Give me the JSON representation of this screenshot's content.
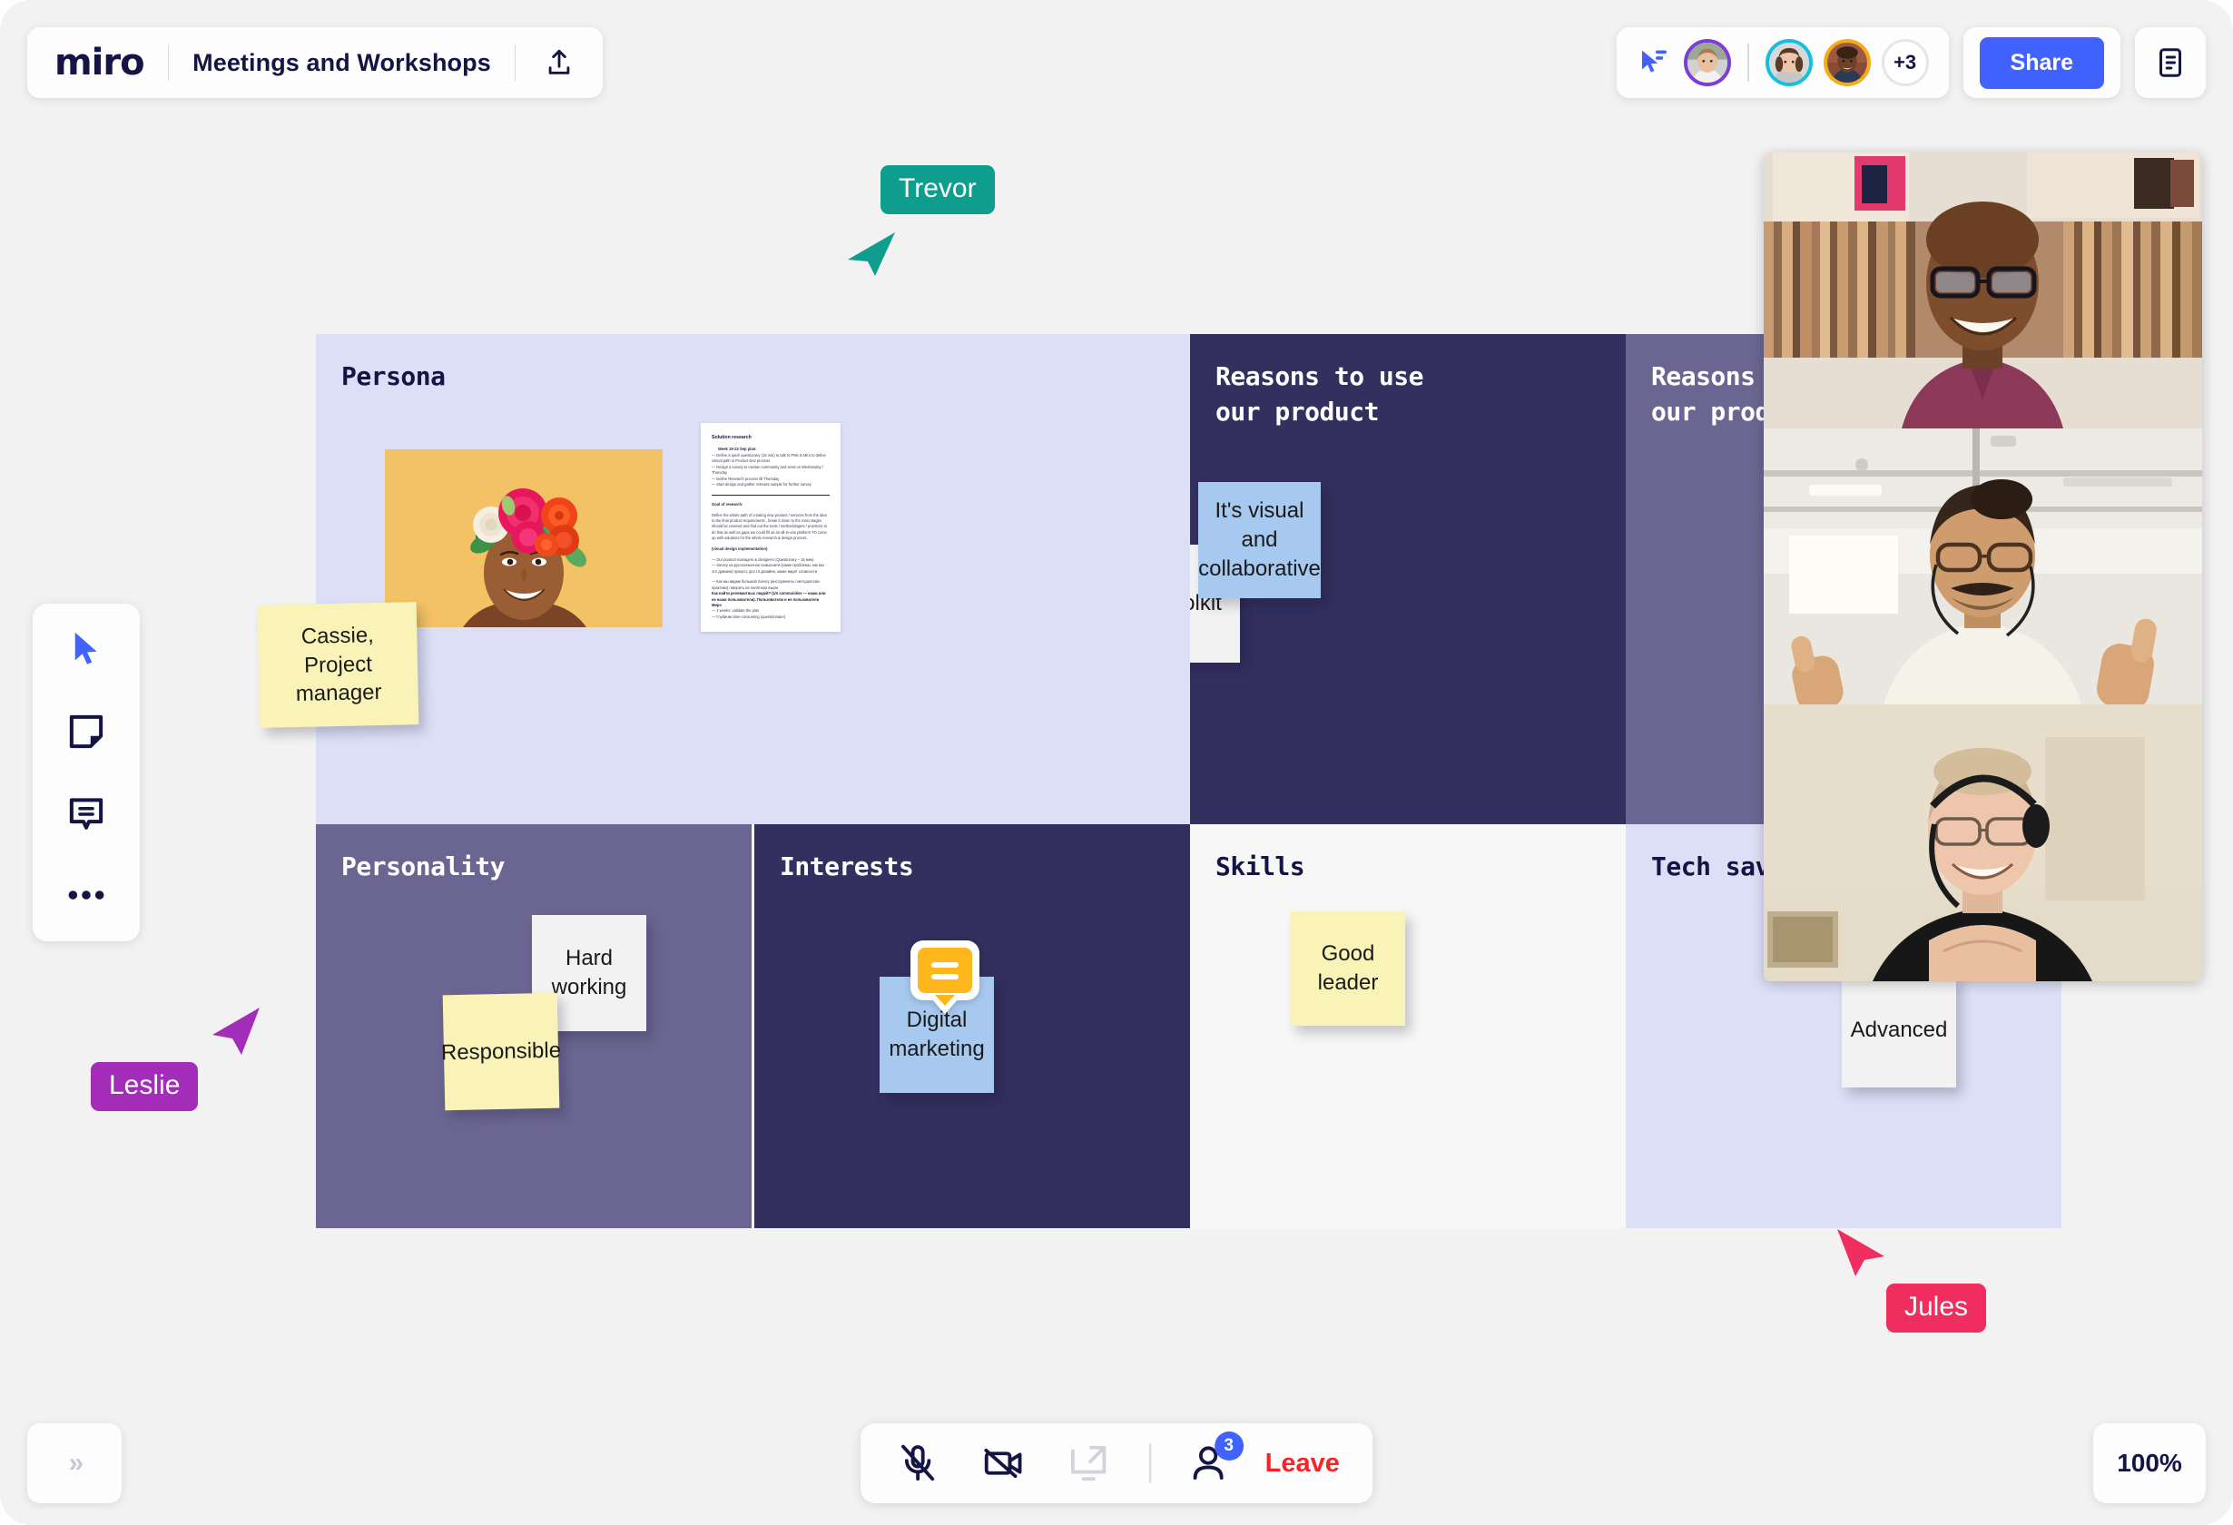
{
  "app": {
    "logo_text": "miro",
    "board_title": "Meetings and Workshops",
    "zoom_level": "100%",
    "expand_label": "»"
  },
  "header": {
    "upload_icon": "upload-icon",
    "follow_cursor_icon": "follow-cursor-icon",
    "share_label": "Share",
    "notes_icon": "notes-panel-icon",
    "overflow_count": "+3",
    "avatars": [
      {
        "name": "avatar-1",
        "ring": "#7b3fd4"
      },
      {
        "name": "avatar-2",
        "ring": "#15c0de"
      },
      {
        "name": "avatar-3",
        "ring": "#f5ac15"
      }
    ]
  },
  "left_toolbar": {
    "items": [
      {
        "icon": "cursor-select-icon",
        "label": "Select",
        "active": true
      },
      {
        "icon": "sticky-note-icon",
        "label": "Sticky note",
        "active": false
      },
      {
        "icon": "comment-icon",
        "label": "Comment",
        "active": false
      },
      {
        "icon": "more-options-icon",
        "label": "More",
        "active": false
      }
    ]
  },
  "board": {
    "panels": [
      {
        "name": "persona",
        "title": "Persona",
        "bg": "#dcdff5",
        "fg": "#141445"
      },
      {
        "name": "reasons-1",
        "title": "Reasons to use\nour product",
        "bg": "#332f5e",
        "fg": "#ffffff"
      },
      {
        "name": "reasons-2",
        "title": "Reasons to use\nour product",
        "bg": "#6b6691",
        "fg": "#ffffff"
      },
      {
        "name": "personality",
        "title": "Personality",
        "bg": "#6b6691",
        "fg": "#ffffff"
      },
      {
        "name": "interests",
        "title": "Interests",
        "bg": "#332f5e",
        "fg": "#ffffff"
      },
      {
        "name": "skills",
        "title": "Skills",
        "bg": "#f7f7f7",
        "fg": "#141445"
      },
      {
        "name": "tech-savvy",
        "title": "Tech savvy",
        "bg": "#dcdff5",
        "fg": "#141445"
      }
    ],
    "stickies": [
      {
        "name": "sticky-cassie",
        "text": "Cassie,\nProject\nmanager",
        "color": "#faf3b8"
      },
      {
        "name": "sticky-its-toolkit",
        "text": "Its toolkit",
        "color": "#f2f2f2"
      },
      {
        "name": "sticky-visual-collaborative",
        "text": "It's visual and\ncollaborative",
        "color": "#a7c8ef"
      },
      {
        "name": "sticky-hard-working",
        "text": "Hard working",
        "color": "#f2f2f2"
      },
      {
        "name": "sticky-responsible",
        "text": "Responsible",
        "color": "#faf3b8"
      },
      {
        "name": "sticky-digital-marketing",
        "text": "Digital\nmarketing",
        "color": "#a7c8ef"
      },
      {
        "name": "sticky-good-leader",
        "text": "Good\nleader",
        "color": "#faf3b8"
      },
      {
        "name": "sticky-advanced",
        "text": "Advanced",
        "color": "#f2f2f2"
      }
    ],
    "comment_badge": {
      "name": "comment-badge",
      "color": "#ffb71b"
    }
  },
  "document_card": {
    "title": "Solution research",
    "week_heading": "Week 19-23 Sep plan:",
    "week_lines": [
      "— Define a quick questionary (15 min) to talk to PMs in Miro to define critical path in Product Dev process",
      "— Design a survey to russian community and send on Wednesday / Thursday",
      "— Define Research process till Thursday",
      "— Start design and gather relevant sample for further survey"
    ],
    "goal_heading": "Goal of research:",
    "goal_body": "Define the whole path of creating new product / services from the idea to the final product requirements , break it down to the main stages should be covered and find out the tools / methodologies / practices to do that as well as gaps we could fill as an all-in-one platform TO come up with solutions for the whole research & design process.",
    "visual_heading": "(visual design implementation)",
    "visual_lines": [
      "— Our product managers & designers (Questionary – 15 мин)",
      "— Survey на русскоязычное комьюнити (какие проблемы, как мы это думаем) процесс дпо UI дизайна, какие видят сложности",
      "— Как мы видим большой Survey (инструменты / методологии практики) говорить на понятном языке."
    ],
    "bold_line": "Как найти релевантных людей? (UX communities — наши или не наши пользователи). Пользователи и не пользователи Миро",
    "tail_lines": [
      "— 2 weeks: validate the plan",
      "— Глубинки time-consuming (questionnaire)"
    ]
  },
  "cursors": [
    {
      "name": "cursor-trevor",
      "label": "Trevor",
      "color": "#0f9e8e",
      "direction": "down-left"
    },
    {
      "name": "cursor-leslie",
      "label": "Leslie",
      "color": "#a32cb8",
      "direction": "up-right"
    },
    {
      "name": "cursor-jules",
      "label": "Jules",
      "color": "#ef2d5e",
      "direction": "up-left"
    }
  ],
  "video_panel": {
    "tiles": [
      {
        "name": "video-tile-1"
      },
      {
        "name": "video-tile-2"
      },
      {
        "name": "video-tile-3"
      }
    ]
  },
  "call_bar": {
    "mic": {
      "icon": "microphone-muted-icon",
      "state": "muted"
    },
    "camera": {
      "icon": "camera-muted-icon",
      "state": "muted"
    },
    "screen_share": {
      "icon": "share-screen-icon",
      "state": "disabled"
    },
    "participants": {
      "icon": "participants-icon",
      "count": "3"
    },
    "leave_label": "Leave"
  }
}
